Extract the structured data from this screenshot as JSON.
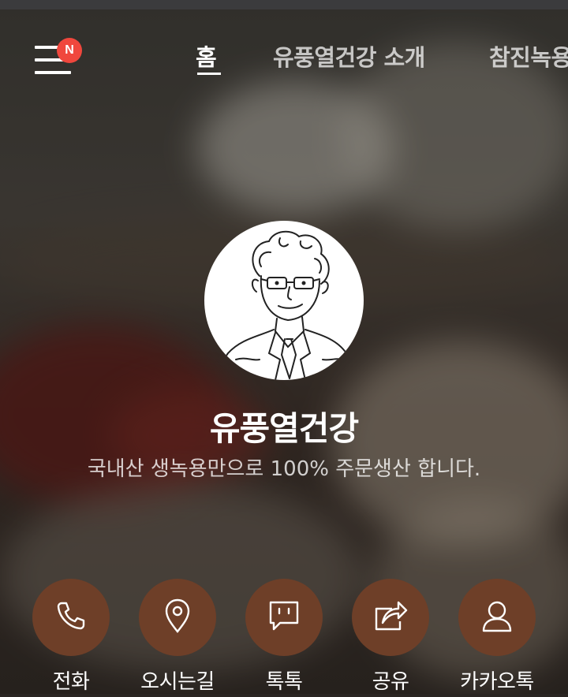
{
  "menu": {
    "badge": "N",
    "icon": "hamburger-menu-icon"
  },
  "nav": {
    "tabs": [
      {
        "label": "홈",
        "active": true
      },
      {
        "label": "유풍열건강 소개",
        "active": false
      },
      {
        "label": "참진녹용",
        "active": false
      }
    ]
  },
  "profile": {
    "name": "유풍열건강",
    "description": "국내산 생녹용만으로 100% 주문생산 합니다."
  },
  "actions": [
    {
      "label": "전화",
      "icon": "phone-icon"
    },
    {
      "label": "오시는길",
      "icon": "location-pin-icon"
    },
    {
      "label": "톡톡",
      "icon": "chat-bubble-icon"
    },
    {
      "label": "공유",
      "icon": "share-icon"
    },
    {
      "label": "카카오톡",
      "icon": "person-icon"
    }
  ],
  "colors": {
    "action_bg": "#6e3f28",
    "badge": "#f0473d"
  }
}
